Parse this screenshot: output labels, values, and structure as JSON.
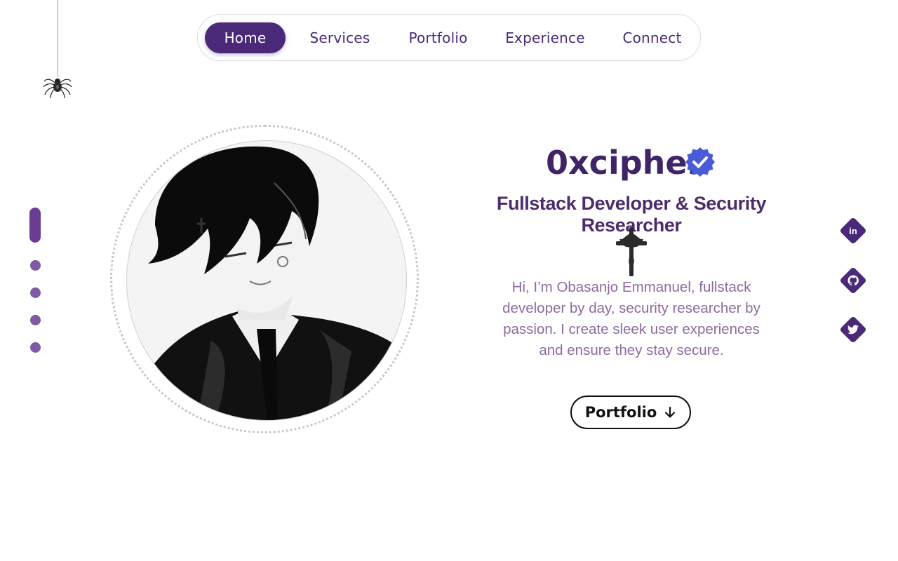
{
  "nav": {
    "items": [
      {
        "label": "Home",
        "active": true
      },
      {
        "label": "Services",
        "active": false
      },
      {
        "label": "Portfolio",
        "active": false
      },
      {
        "label": "Experience",
        "active": false
      },
      {
        "label": "Connect",
        "active": false
      }
    ]
  },
  "pager": {
    "count": 5,
    "active_index": 0
  },
  "hero": {
    "name": "0xcipher",
    "subtitle": "Fullstack Developer & Security Researcher",
    "intro": "Hi, I’m Obasanjo Emmanuel, fullstack developer by day, security researcher by passion. I create sleek user experiences and ensure they stay secure.",
    "cta_label": "Portfolio",
    "cta_icon": "arrow-down-icon",
    "verified_icon": "verified-badge-icon"
  },
  "socials": [
    {
      "name": "linkedin",
      "icon": "linkedin-icon",
      "glyph": "in"
    },
    {
      "name": "github",
      "icon": "github-icon",
      "glyph": "⌥"
    },
    {
      "name": "twitter",
      "icon": "twitter-icon",
      "glyph": "✦"
    }
  ],
  "decor": {
    "spider_icon": "spider-icon",
    "cross_icon": "ornate-cross-icon",
    "portrait": "anime-portrait-illustration"
  },
  "colors": {
    "accent": "#4a2a78",
    "heading": "#3f2468",
    "body_text": "#8d6a9f",
    "verified_badge": "#4a5bd6",
    "pager": "#7d5aa3"
  }
}
